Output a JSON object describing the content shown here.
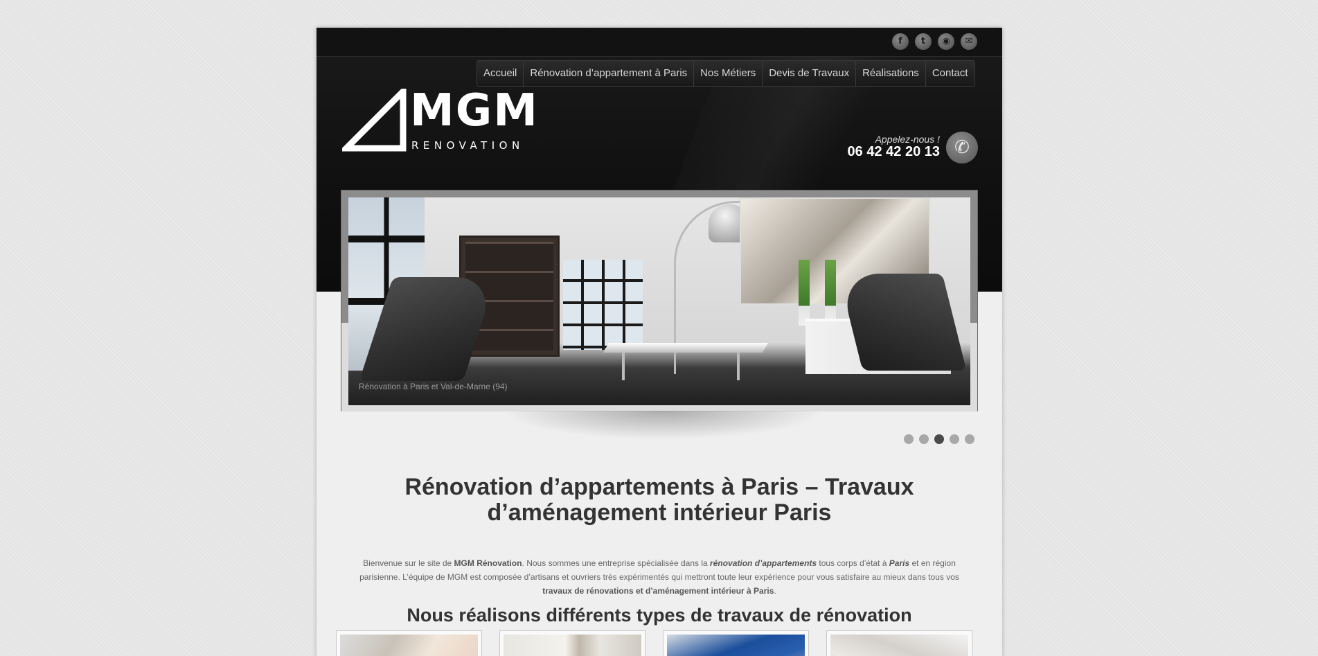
{
  "social": [
    {
      "icon": "facebook-icon",
      "glyph": "f"
    },
    {
      "icon": "twitter-icon",
      "glyph": "t"
    },
    {
      "icon": "rss-icon",
      "glyph": "◉"
    },
    {
      "icon": "mail-icon",
      "glyph": "✉"
    }
  ],
  "nav": [
    "Accueil",
    "Rénovation d’appartement à Paris",
    "Nos Métiers",
    "Devis de Travaux",
    "Réalisations",
    "Contact"
  ],
  "logo": {
    "mgm": "MGM",
    "sub": "RENOVATION"
  },
  "phone": {
    "label": "Appelez-nous !",
    "number": "06 42 42 20 13",
    "icon": "phone-icon"
  },
  "slider": {
    "caption": "Rénovation à Paris et Val-de-Marne (94)",
    "dot_count": 5,
    "active_dot": 3
  },
  "main": {
    "title_line1": "Rénovation d’appartements à Paris – Travaux",
    "title_line2": "d’aménagement intérieur Paris",
    "intro": {
      "p1": "Bienvenue sur le site de ",
      "company": "MGM Rénovation",
      "p2": ". Nous sommes une entreprise spécialisée dans la ",
      "em1": "rénovation d’appartements",
      "p3": " tous corps d’état à ",
      "em2": "Paris",
      "p4": " et en région parisienne. L’équipe de MGM est composée d’artisans et ouvriers très expérimentés qui mettront toute leur expérience pour vous satisfaire au mieux dans tous vos ",
      "strong2": "travaux de rénovations et d’aménagement intérieur à Paris",
      "p5": "."
    },
    "subtitle": "Nous réalisons différents types de travaux de rénovation"
  },
  "colors": {
    "header_bg": "#111111",
    "page_bg": "#efefef",
    "text_dark": "#333333",
    "active_dot": "#4a4a4a"
  }
}
